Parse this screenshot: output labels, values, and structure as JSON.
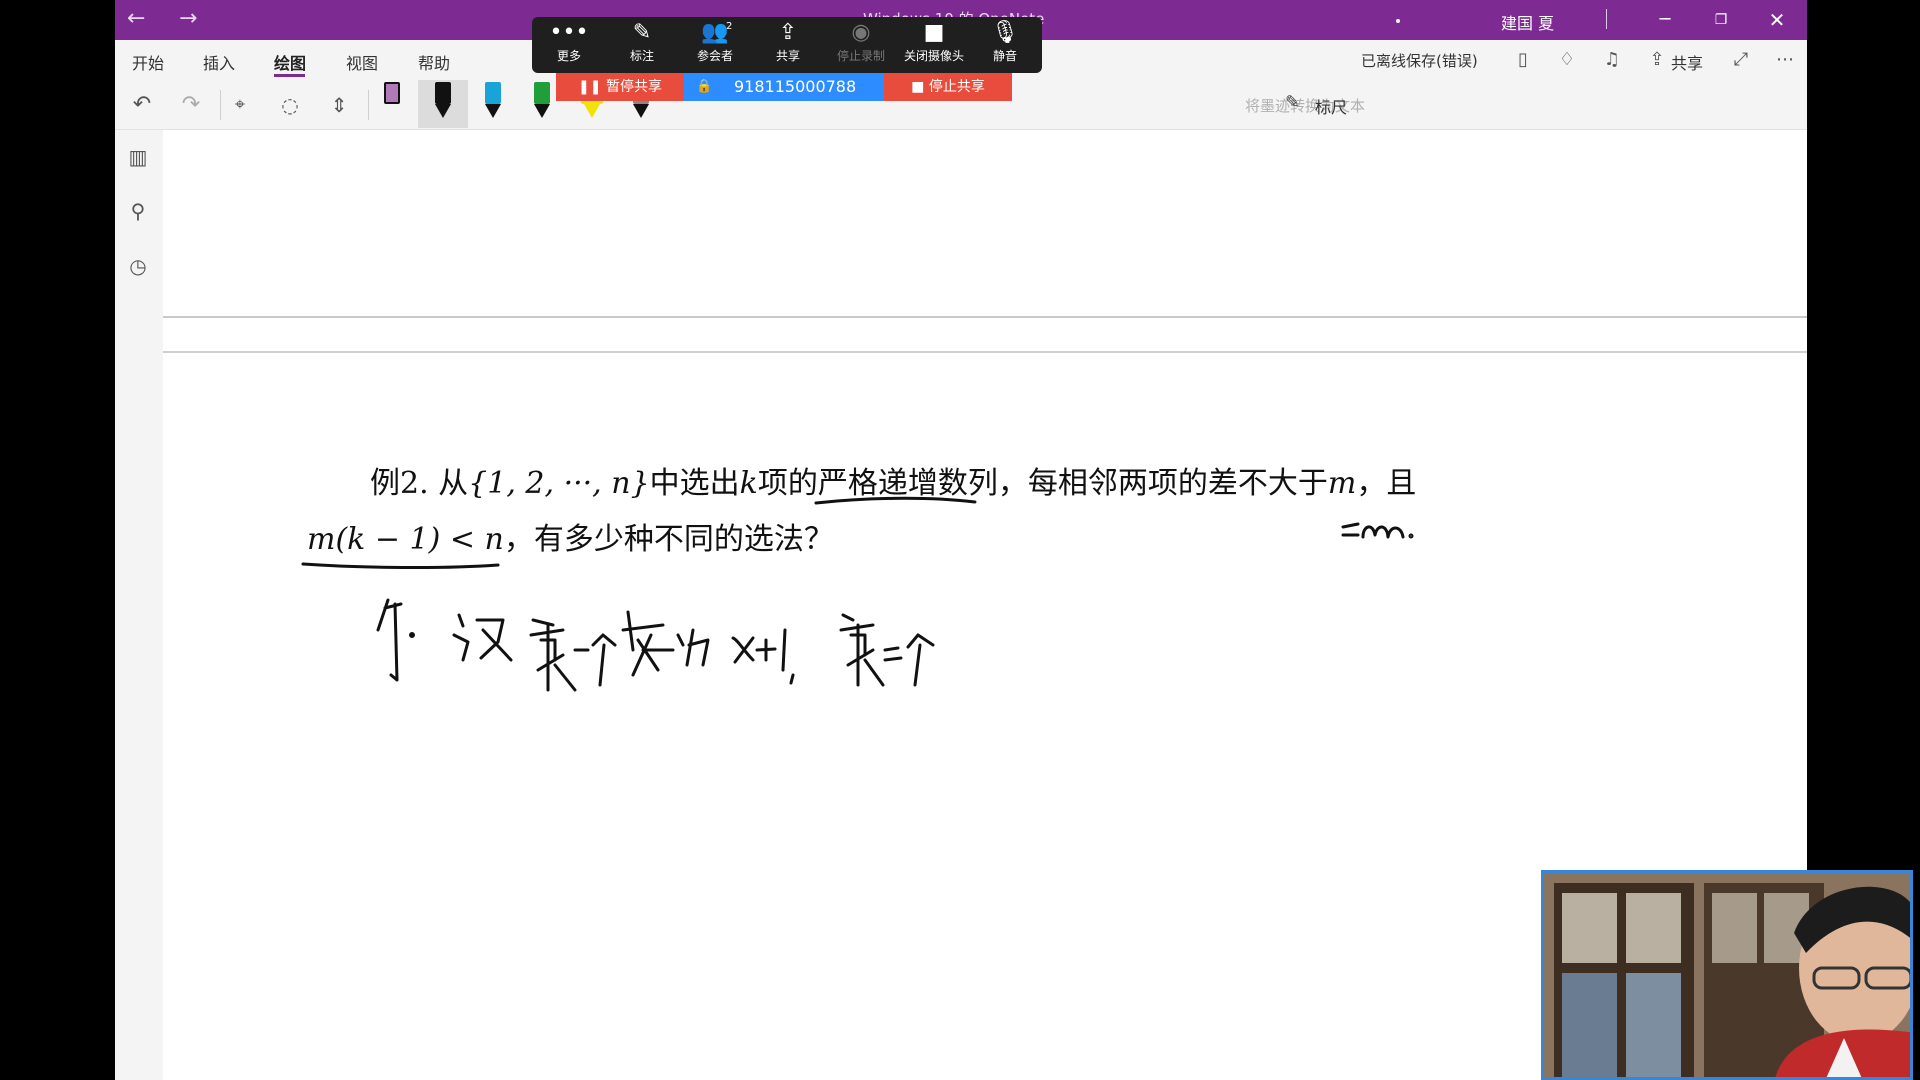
{
  "titlebar": {
    "back": "←",
    "forward": "→",
    "title": "Windows 10 的 OneNote",
    "user": "建国 夏",
    "minimize": "─",
    "restore": "❐",
    "close": "✕"
  },
  "ribbon": {
    "tabs": [
      "开始",
      "插入",
      "绘图",
      "视图",
      "帮助"
    ],
    "save_status": "已离线保存(错误)",
    "share": "共享"
  },
  "toolbar": {
    "undo": "↶",
    "redo": "↷",
    "ink_to_text": "将墨迹转换为文本",
    "ruler": "标尺",
    "pen_colors": [
      "#b07ab8",
      "#111111",
      "#1aa3d8",
      "#1f9e3a",
      "#f2e20b",
      "#888888"
    ]
  },
  "meeting": {
    "buttons": [
      "更多",
      "标注",
      "参会者",
      "共享",
      "停止录制",
      "关闭摄像头",
      "静音"
    ],
    "attendee_count": "2",
    "pause_share": "暂停共享",
    "meeting_id": "918115000788",
    "stop_share": "停止共享"
  },
  "problem": {
    "line1_a": "例2. 从",
    "line1_set": "{1, 2, ···, n}",
    "line1_b": "中选出",
    "line1_k": "k",
    "line1_c": "项的",
    "line1_underlined": "严格递增数列",
    "line1_d": "，每相邻两项的差不大于",
    "line1_m": "m",
    "line1_e": "，且",
    "line2_cond": "m(k − 1) < n",
    "line2_rest": "，有多少种不同的选法？"
  },
  "ink": {
    "side_note": "≤m.",
    "solution_handwriting": "解. 设第一个数为 x+1, 第二个"
  },
  "colors": {
    "brand": "#7d2a92",
    "share_red": "#e74c3c",
    "meeting_blue": "#2d8cff"
  }
}
